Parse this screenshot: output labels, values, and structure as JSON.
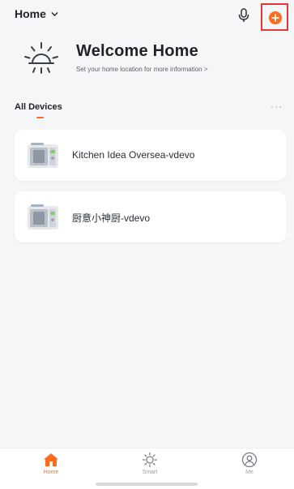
{
  "header": {
    "home_label": "Home"
  },
  "welcome": {
    "title": "Welcome Home",
    "subtitle": "Set your home location for more information >"
  },
  "section": {
    "title": "All Devices",
    "more": "···"
  },
  "devices": [
    {
      "name": "Kitchen Idea Oversea-vdevo"
    },
    {
      "name": "厨意小神厨-vdevo"
    }
  ],
  "tabbar": {
    "tabs": [
      {
        "label": "Home",
        "active": true
      },
      {
        "label": "Smart",
        "active": false
      },
      {
        "label": "Me",
        "active": false
      }
    ]
  },
  "colors": {
    "accent": "#ff6b1a",
    "highlight_frame": "#e53935",
    "background": "#f5f6f8",
    "card": "#ffffff"
  }
}
